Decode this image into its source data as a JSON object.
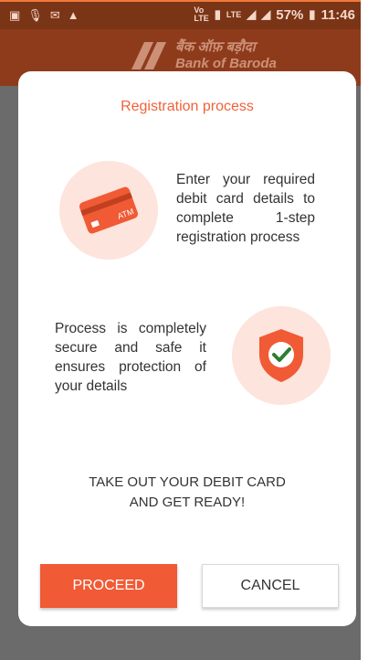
{
  "status_bar": {
    "battery_text": "57%",
    "time": "11:46",
    "network_label": "LTE"
  },
  "app_bar": {
    "bank_name_hindi": "बैंक ऑफ़ बड़ौदा",
    "bank_name_english": "Bank of Baroda"
  },
  "dialog": {
    "title": "Registration process",
    "card_info": "Enter your required debit card details to complete 1-step registration process",
    "card_icon_label": "ATM",
    "secure_info": "Process is completely secure and safe it ensures protection of your details",
    "ready_line1": "TAKE OUT YOUR DEBIT CARD",
    "ready_line2": "AND GET READY!",
    "proceed_label": "PROCEED",
    "cancel_label": "CANCEL"
  },
  "colors": {
    "accent": "#f05a35",
    "circle_bg": "#fde4dc",
    "appbar": "#8e3b1c",
    "check_green": "#2e7d32"
  },
  "icons": [
    "atm-card-icon",
    "shield-check-icon",
    "bank-logo-icon"
  ]
}
